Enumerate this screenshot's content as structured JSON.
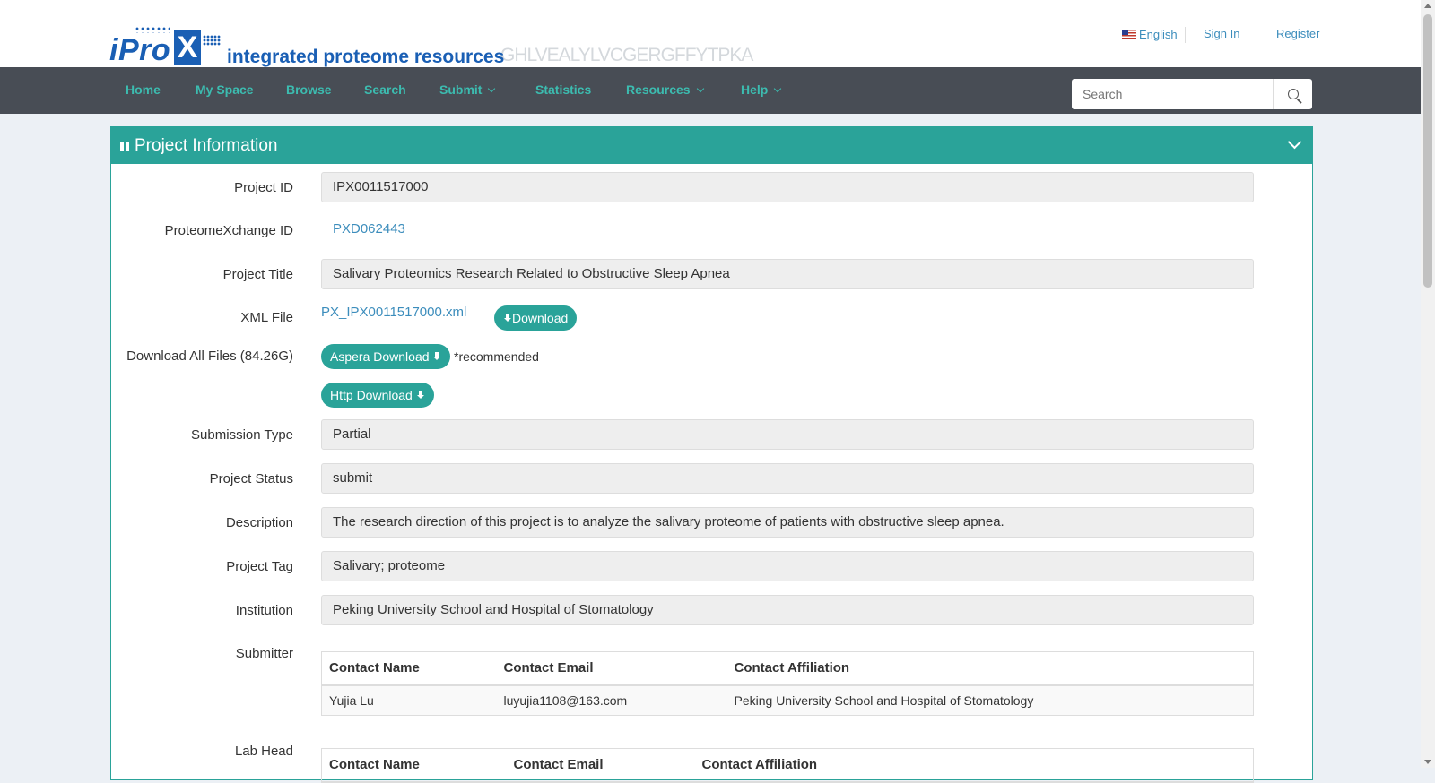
{
  "header": {
    "logo_prefix": "iPro",
    "logo_x": "X",
    "logo_subtitle": "integrated proteome resources",
    "logo_sequence": "GHLVEALYLVCGERGFFYTPKA"
  },
  "top_links": {
    "language": "English",
    "sign_in": "Sign In",
    "register": "Register"
  },
  "nav": {
    "items": [
      {
        "label": "Home"
      },
      {
        "label": "My Space"
      },
      {
        "label": "Browse"
      },
      {
        "label": "Search"
      },
      {
        "label": "Submit"
      },
      {
        "label": "Statistics"
      },
      {
        "label": "Resources"
      },
      {
        "label": "Help"
      }
    ],
    "search_placeholder": "Search"
  },
  "panel": {
    "title": "Project Information",
    "project_id_label": "Project ID",
    "project_id": "IPX0011517000",
    "px_label": "ProteomeXchange ID",
    "px_id": "PXD062443",
    "title_label": "Project Title",
    "project_title": "Salivary Proteomics Research Related to Obstructive Sleep Apnea",
    "xml_label": "XML File",
    "xml_file": "PX_IPX0011517000.xml",
    "download_label": "Download",
    "download_all_label": "Download All Files (84.26G)",
    "aspera_label": "Aspera Download",
    "recommended": "*recommended",
    "http_label": "Http Download",
    "submission_type_label": "Submission Type",
    "submission_type": "Partial",
    "status_label": "Project Status",
    "status": "submit",
    "description_label": "Description",
    "description": "The research direction of this project is to analyze the salivary proteome of patients with obstructive sleep apnea.",
    "tag_label": "Project Tag",
    "tag": "Salivary; proteome",
    "institution_label": "Institution",
    "institution": "Peking University School and Hospital of Stomatology",
    "submitter_label": "Submitter",
    "submitter_table": {
      "headers": [
        "Contact Name",
        "Contact Email",
        "Contact Affiliation"
      ],
      "rows": [
        [
          "Yujia Lu",
          "luyujia1108@163.com",
          "Peking University School and Hospital of Stomatology"
        ]
      ]
    },
    "labhead_label": "Lab Head",
    "labhead_table": {
      "headers": [
        "Contact Name",
        "Contact Email",
        "Contact Affiliation"
      ]
    }
  },
  "colors": {
    "accent": "#2aa399",
    "nav_bg": "#484d55",
    "nav_text": "#3cbcb0",
    "link": "#3c8dbc"
  }
}
